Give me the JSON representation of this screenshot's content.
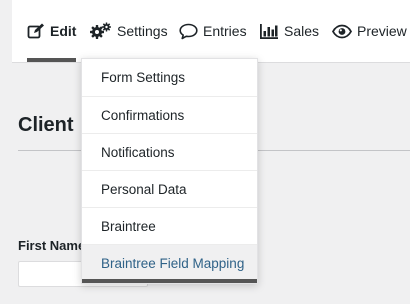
{
  "toolbar": {
    "tabs": [
      {
        "label": "Edit",
        "icon": "edit-icon"
      },
      {
        "label": "Settings",
        "icon": "gears-icon"
      },
      {
        "label": "Entries",
        "icon": "comment-icon"
      },
      {
        "label": "Sales",
        "icon": "bar-chart-icon"
      },
      {
        "label": "Preview",
        "icon": "eye-icon"
      }
    ],
    "active_tab": "Edit"
  },
  "settings_menu": {
    "items": [
      {
        "label": "Form Settings"
      },
      {
        "label": "Confirmations"
      },
      {
        "label": "Notifications"
      },
      {
        "label": "Personal Data"
      },
      {
        "label": "Braintree"
      },
      {
        "label": "Braintree Field Mapping"
      }
    ],
    "highlighted_item": "Braintree Field Mapping"
  },
  "main": {
    "heading": "Client",
    "field_label": "First Name"
  },
  "colors": {
    "highlight_text": "#2f6288",
    "active_underline": "#555555"
  }
}
